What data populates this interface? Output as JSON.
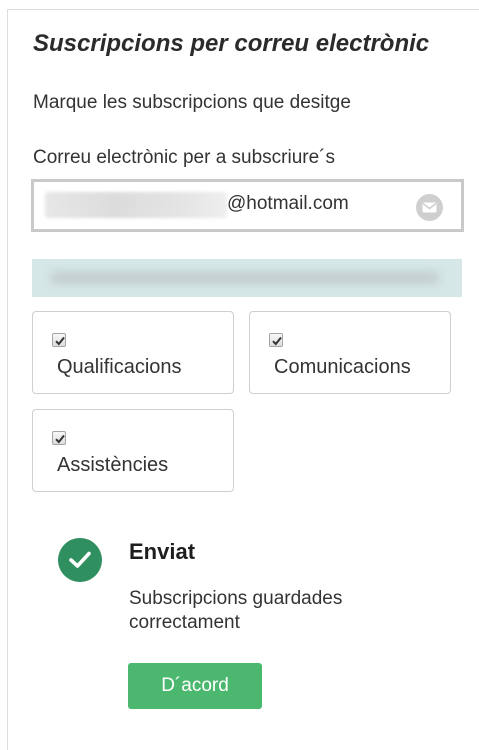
{
  "form": {
    "title": "Suscripcions per correu electrònic",
    "subtitle": "Marque les subscripcions que desitge",
    "email_label": "Correu electrònic per a subscriure´s",
    "email_value_domain": "@hotmail.com",
    "email_icon": "mail-icon"
  },
  "options": [
    {
      "label": "Qualificacions",
      "checked": true
    },
    {
      "label": "Comunicacions",
      "checked": true
    },
    {
      "label": "Assistències",
      "checked": true
    }
  ],
  "success": {
    "icon": "check-circle-icon",
    "title": "Enviat",
    "message": "Subscripcions guardades correctament",
    "ok_label": "D´acord"
  },
  "colors": {
    "success_green": "#2f8f5e",
    "button_green": "#4cb86f",
    "banner": "#d6e7e7"
  }
}
